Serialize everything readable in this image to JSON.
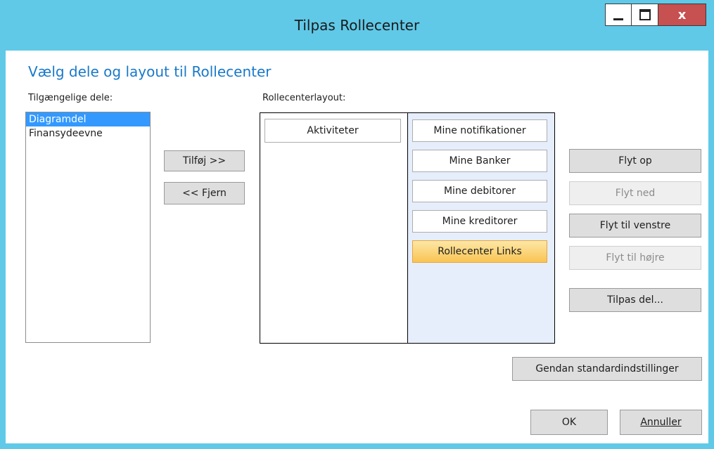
{
  "window": {
    "title": "Tilpas Rollecenter",
    "close_glyph": "x"
  },
  "dialog": {
    "heading": "Vælg dele og layout til Rollecenter",
    "available_label": "Tilgængelige dele:",
    "available_items": [
      {
        "label": "Diagramdel",
        "selected": true
      },
      {
        "label": "Finansydeevne",
        "selected": false
      }
    ],
    "add_button": "Tilføj >>",
    "remove_button": "<< Fjern",
    "layout_label": "Rollecenterlayout:",
    "layout_columns": {
      "left": [
        "Aktiviteter"
      ],
      "right": [
        "Mine notifikationer",
        "Mine Banker",
        "Mine debitorer",
        "Mine kreditorer",
        "Rollecenter Links"
      ]
    },
    "move_up": "Flyt op",
    "move_down": "Flyt ned",
    "move_left": "Flyt til venstre",
    "move_right": "Flyt til højre",
    "customize_part": "Tilpas del...",
    "restore_defaults": "Gendan standardindstillinger",
    "ok": "OK",
    "cancel": "Annuller"
  }
}
